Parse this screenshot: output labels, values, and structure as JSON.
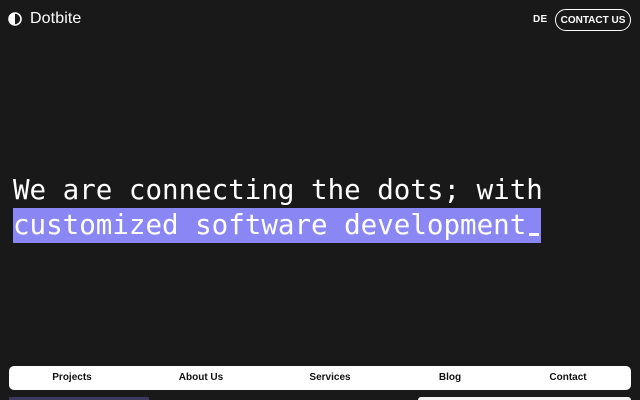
{
  "header": {
    "brand": "Dotbite",
    "logo_icon": "half-circle-logo-icon",
    "language": "DE",
    "contact_label": "CONTACT US"
  },
  "hero": {
    "line1": "We are connecting the dots; with",
    "line2": "customized software development",
    "highlight_color": "#8a86f4"
  },
  "nav": {
    "items": [
      {
        "label": "Projects"
      },
      {
        "label": "About Us"
      },
      {
        "label": "Services"
      },
      {
        "label": "Blog"
      },
      {
        "label": "Contact"
      }
    ]
  },
  "colors": {
    "background": "#191919",
    "text": "#ffffff",
    "accent": "#8a86f4",
    "nav_bar": "#ffffff"
  }
}
